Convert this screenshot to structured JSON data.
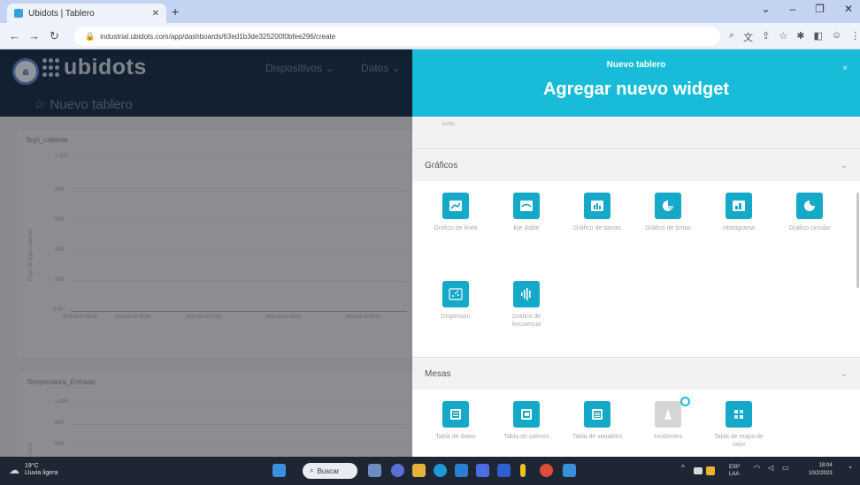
{
  "browser": {
    "tab_title": "Ubidots | Tablero",
    "url": "industrial.ubidots.com/app/dashboards/63ed1b3de325200f0bfee296/create"
  },
  "app": {
    "logo": "ubidots",
    "nav": [
      "Dispositivos",
      "Datos"
    ],
    "board_title": "Nuevo tablero",
    "charts": [
      {
        "title": "flujo_caliente",
        "y_ticks": [
          "1.000",
          "800",
          "600",
          "400",
          "200",
          "0.00"
        ],
        "y_label": "Flujo de agua caliente",
        "x_ticks": [
          "2023-02-10 00:00",
          "2023-02-10 06:00",
          "2023-02-10 12:00",
          "2023-02-10 18:00",
          "2023-02-11 00:00"
        ]
      },
      {
        "title": "Temperatura_Entrada",
        "y_ticks": [
          "1.000",
          "800",
          "600"
        ],
        "y_label": "Temp"
      }
    ]
  },
  "drawer": {
    "subtitle": "Nuevo tablero",
    "title": "Agregar nuevo widget",
    "close": "×",
    "prev_label": "estilo",
    "sections": [
      {
        "title": "Gráficos",
        "widgets": [
          {
            "label": "Gráfico de línea",
            "icon": "line-chart-icon"
          },
          {
            "label": "Eje doble",
            "icon": "double-axis-icon"
          },
          {
            "label": "Gráfico de barras",
            "icon": "bar-chart-icon"
          },
          {
            "label": "Gráfico de tortas",
            "icon": "pie-chart-icon"
          },
          {
            "label": "Histograma",
            "icon": "histogram-icon"
          },
          {
            "label": "Gráfico circular",
            "icon": "donut-chart-icon"
          },
          {
            "label": "Dispersión",
            "icon": "scatter-icon"
          },
          {
            "label": "Gráfico de frecuencia",
            "icon": "frequency-icon"
          }
        ]
      },
      {
        "title": "Mesas",
        "widgets": [
          {
            "label": "Tabla de datos",
            "icon": "table-icon"
          },
          {
            "label": "Tabla de valores",
            "icon": "table-values-icon"
          },
          {
            "label": "Tabla de variables",
            "icon": "table-variables-icon"
          },
          {
            "label": "Incidentes",
            "icon": "incidents-icon"
          },
          {
            "label": "Tabla de mapa de calor",
            "icon": "heatmap-table-icon"
          }
        ]
      }
    ]
  },
  "taskbar": {
    "weather_temp": "19°C",
    "weather_desc": "Lluvia ligera",
    "search": "Buscar",
    "lang": "ESP",
    "lang_sub": "LAA",
    "time": "18:04",
    "date": "10/2/2023"
  }
}
